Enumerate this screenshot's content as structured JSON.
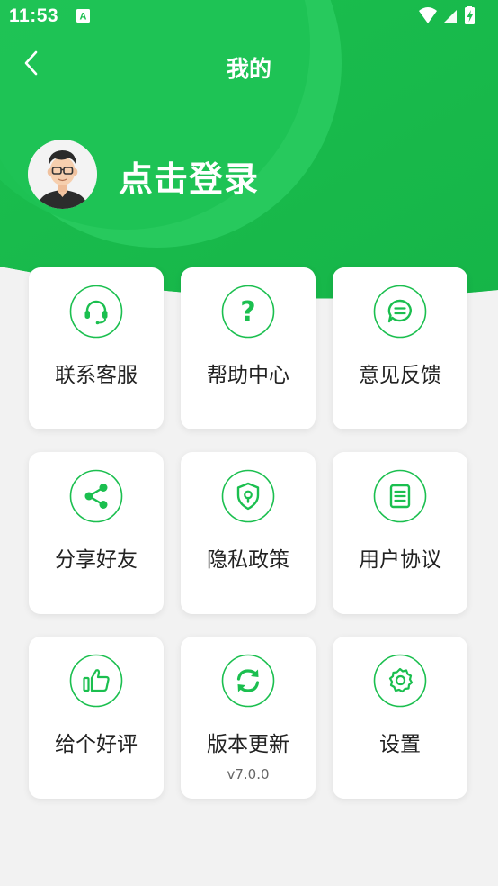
{
  "status_bar": {
    "time": "11:53",
    "notification_icon": "font-a-icon",
    "wifi_icon": "wifi-icon",
    "signal_icon": "cellular-signal-icon",
    "battery_icon": "battery-charging-icon"
  },
  "header": {
    "title": "我的",
    "back_icon": "chevron-left-icon",
    "login_text": "点击登录",
    "avatar_icon": "user-avatar"
  },
  "colors": {
    "brand_green": "#1bbf4f",
    "header_green_dark": "#16b548",
    "header_green_light": "#2fcf66",
    "page_background": "#f2f2f2",
    "card_background": "#ffffff"
  },
  "menu": {
    "items": [
      {
        "label": "联系客服",
        "icon": "headset-icon"
      },
      {
        "label": "帮助中心",
        "icon": "question-mark-icon"
      },
      {
        "label": "意见反馈",
        "icon": "chat-bubble-icon"
      },
      {
        "label": "分享好友",
        "icon": "share-icon"
      },
      {
        "label": "隐私政策",
        "icon": "shield-icon"
      },
      {
        "label": "用户协议",
        "icon": "document-icon"
      },
      {
        "label": "给个好评",
        "icon": "thumbs-up-icon"
      },
      {
        "label": "版本更新",
        "icon": "refresh-icon",
        "sub": "v7.0.0"
      },
      {
        "label": "设置",
        "icon": "gear-icon"
      }
    ]
  }
}
